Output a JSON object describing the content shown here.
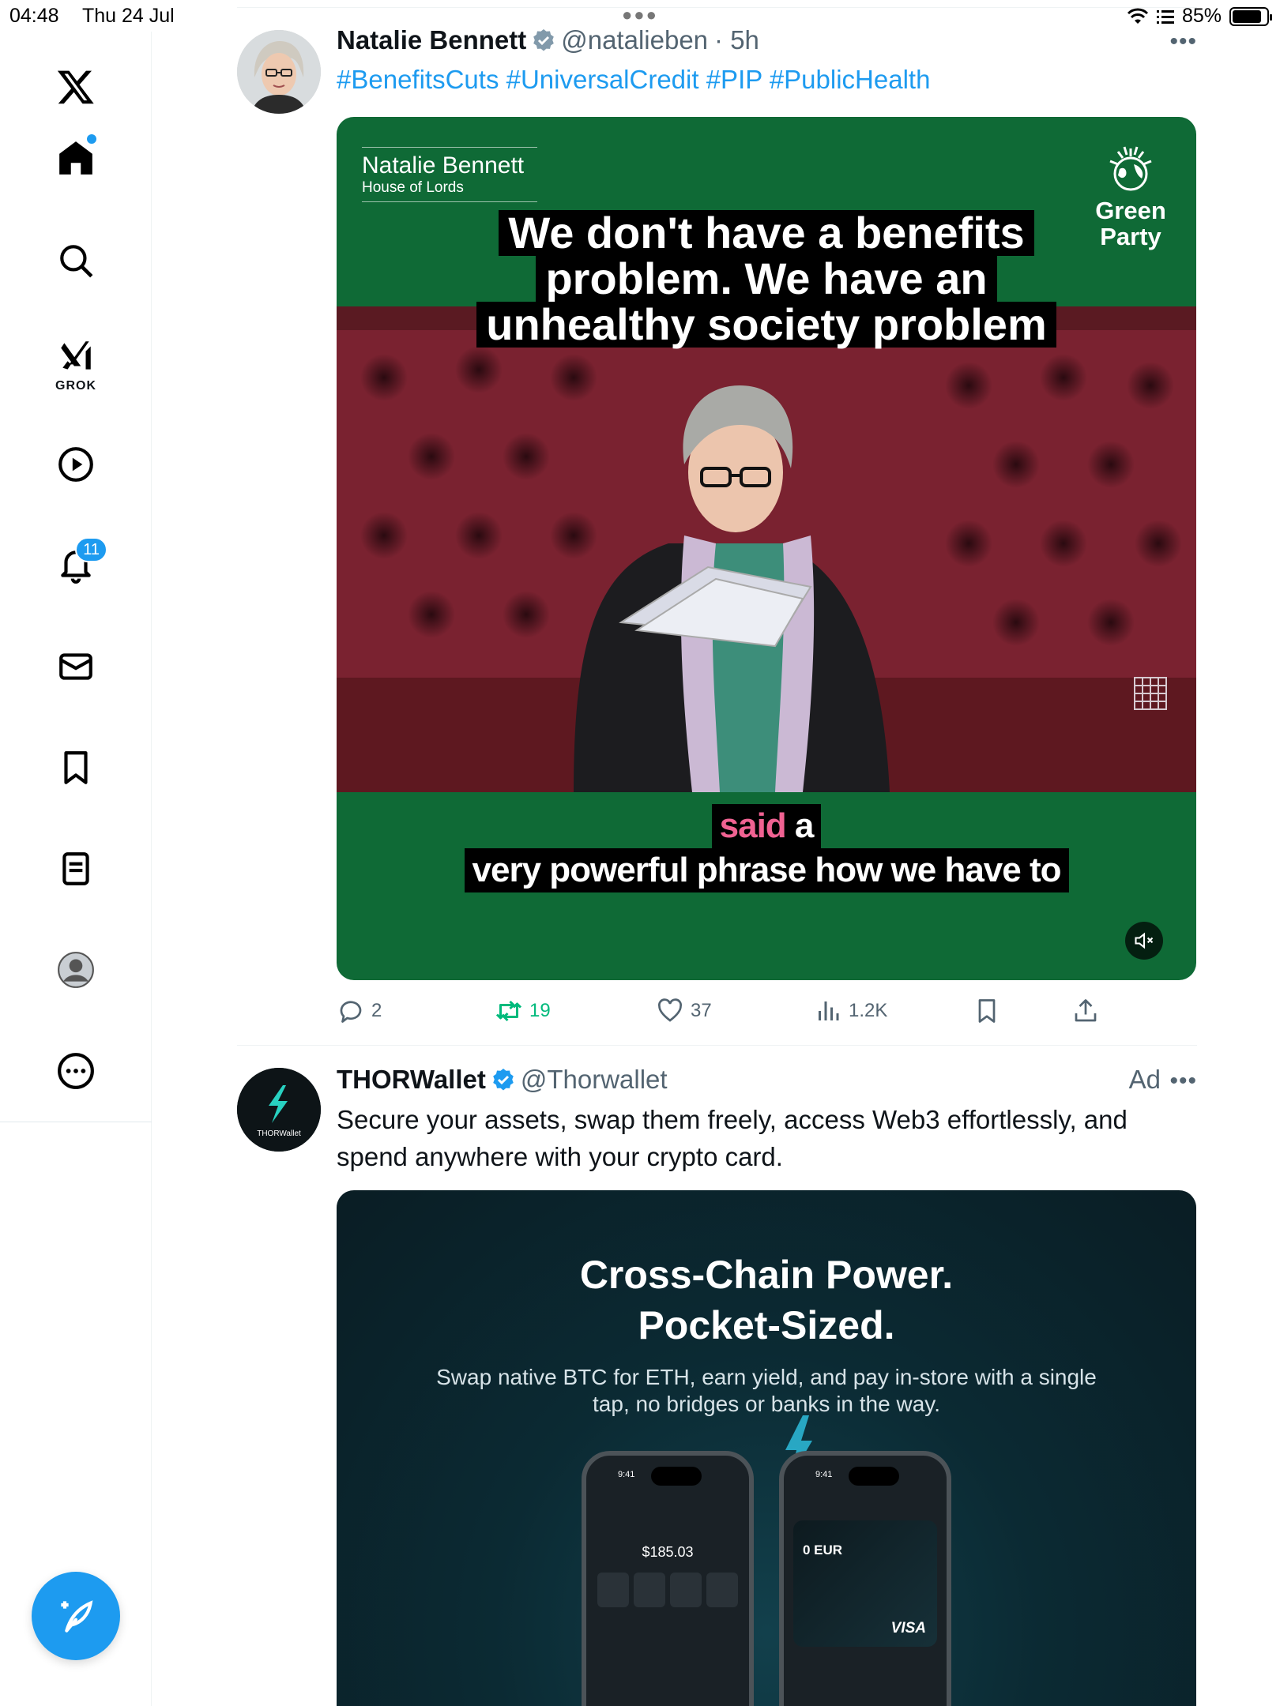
{
  "status_bar": {
    "time": "04:48",
    "date": "Thu 24 Jul",
    "battery": "85%",
    "battery_level": 0.85
  },
  "sidebar": {
    "grok_label": "GROK",
    "notifications_count": "11",
    "icons": [
      "x-logo-icon",
      "home-icon",
      "search-icon",
      "grok-icon",
      "video-icon",
      "bell-icon",
      "mail-icon",
      "bookmark-icon",
      "list-icon",
      "profile-icon",
      "more-icon",
      "compose-icon"
    ]
  },
  "posts": [
    {
      "name": "Natalie Bennett",
      "handle": "@natalieben",
      "time": "· 5h",
      "hashtags": "#BenefitsCuts #UniversalCredit #PIP #PublicHealth",
      "video": {
        "nameplate_name": "Natalie Bennett",
        "nameplate_sub": "House of Lords",
        "party_line1": "Green",
        "party_line2": "Party",
        "caption_lines": [
          "We don't have a benefits",
          "problem. We have an",
          "unhealthy society problem"
        ],
        "subtitle_highlight": "said",
        "subtitle_rest_line1": " a",
        "subtitle_line2": "very powerful phrase how we have to"
      },
      "stats": {
        "replies": "2",
        "reposts": "19",
        "likes": "37",
        "views": "1.2K"
      }
    },
    {
      "name": "THORWallet",
      "handle": "@Thorwallet",
      "ad_label": "Ad",
      "avatar_text": "THORWallet",
      "text": "Secure your assets, swap them freely, access Web3 effortlessly, and spend anywhere with your crypto card.",
      "image": {
        "title_line1": "Cross-Chain Power.",
        "title_line2": "Pocket-Sized.",
        "subtitle": "Swap native BTC for ETH, earn yield, and pay in-store with a single tap, no bridges or banks in the way.",
        "phone1_time": "9:41",
        "phone1_balance": "$185.03",
        "phone2_time": "9:41",
        "phone2_balance": "0 EUR",
        "phone2_brand": "VISA"
      }
    }
  ],
  "colors": {
    "accent": "#1d9bf0",
    "repost": "#00ba7c",
    "green_party": "#0f6a36",
    "text": "#0f1419",
    "muted": "#536471"
  }
}
